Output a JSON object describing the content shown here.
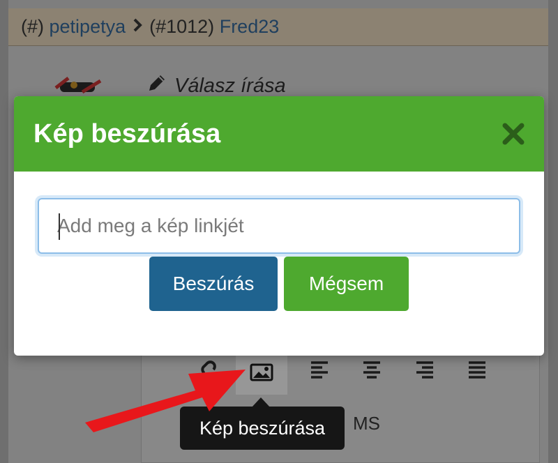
{
  "breadcrumb": {
    "prefix1": "(#)",
    "user": "petipetya",
    "separator_icon": "chevron-right-icon",
    "prefix2": "(#1012)",
    "user2": "Fred23"
  },
  "reply": {
    "label": "Válasz írása",
    "icon": "pencil-icon"
  },
  "modal": {
    "title": "Kép beszúrása",
    "close_icon": "close-icon",
    "input_placeholder": "Add meg a kép linkjét",
    "input_value": "",
    "insert_label": "Beszúrás",
    "cancel_label": "Mégsem"
  },
  "editor": {
    "toolbar": [
      "link-icon",
      "image-icon",
      "align-left-icon",
      "align-center-icon",
      "align-right-icon",
      "align-justify-icon"
    ],
    "partial_text": "MS"
  },
  "tooltip": {
    "text": "Kép beszúrása"
  },
  "colors": {
    "header_green": "#4ea92f",
    "insert_blue": "#1f638f",
    "cancel_green": "#4ea92f",
    "tooltip_bg": "#161616",
    "annotation_red": "#e8171b"
  }
}
